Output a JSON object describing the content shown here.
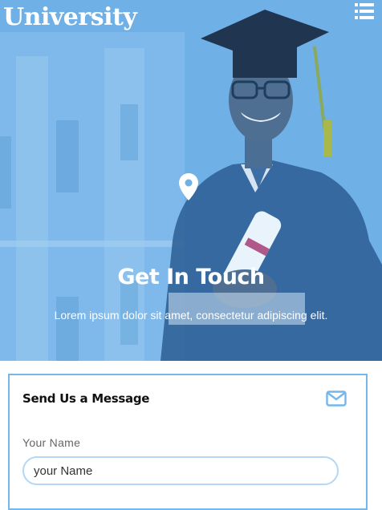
{
  "header": {
    "brand": "University",
    "menu_icon": "list-menu-icon"
  },
  "hero": {
    "location_icon": "map-pin-icon",
    "title": "Get In Touch",
    "subtitle": "Lorem ipsum dolor sit amet, consectetur adipiscing elit."
  },
  "contact_form": {
    "title": "Send Us a Message",
    "mail_icon": "envelope-icon",
    "name_label": "Your Name",
    "name_placeholder": "your Name",
    "name_value": ""
  },
  "colors": {
    "accent": "#74b7ec",
    "overlay": "#6fb0e6"
  }
}
